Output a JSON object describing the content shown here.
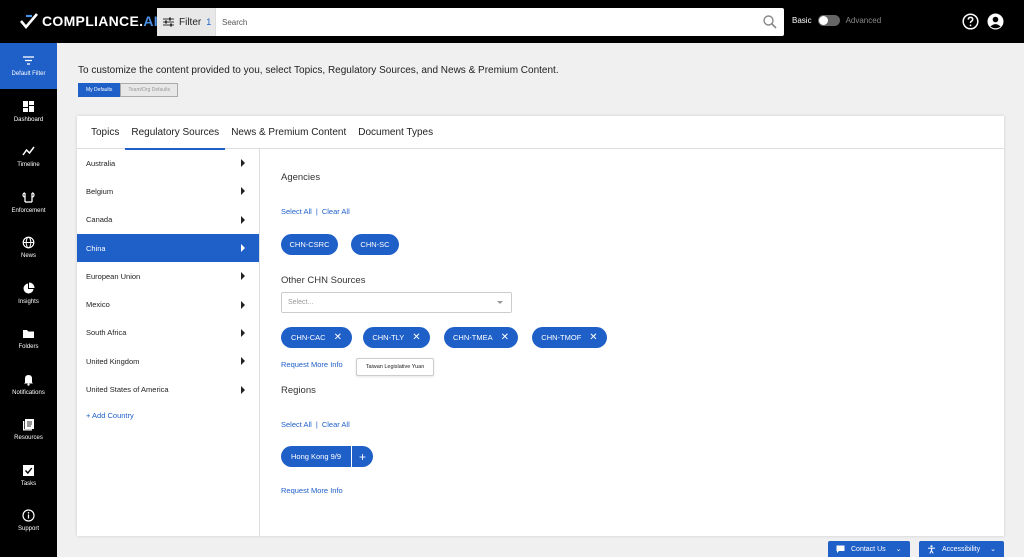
{
  "brand": {
    "name_main": "COMPLIANCE",
    "name_dot": ".",
    "name_ai": "AI"
  },
  "header": {
    "filter_label": "Filter",
    "filter_count": "1",
    "search_placeholder": "Search",
    "mode_basic": "Basic",
    "mode_advanced": "Advanced"
  },
  "sidebar": {
    "items": [
      {
        "label": "Default Filter",
        "icon": "filter-icon"
      },
      {
        "label": "Dashboard",
        "icon": "dashboard-icon"
      },
      {
        "label": "Timeline",
        "icon": "timeline-icon"
      },
      {
        "label": "Enforcement",
        "icon": "enforcement-icon"
      },
      {
        "label": "News",
        "icon": "globe-icon"
      },
      {
        "label": "Insights",
        "icon": "pie-chart-icon"
      },
      {
        "label": "Folders",
        "icon": "folder-icon"
      },
      {
        "label": "Notifications",
        "icon": "bell-icon"
      },
      {
        "label": "Resources",
        "icon": "resources-icon"
      },
      {
        "label": "Tasks",
        "icon": "checkbox-icon"
      },
      {
        "label": "Support",
        "icon": "info-icon"
      }
    ]
  },
  "main": {
    "intro": "To customize the content provided to you, select Topics, Regulatory Sources, and News & Premium Content.",
    "defaults": {
      "my": "My Defaults",
      "team": "Team/Org Defaults"
    },
    "tabs": [
      "Topics",
      "Regulatory Sources",
      "News & Premium Content",
      "Document Types"
    ],
    "countries": [
      "Australia",
      "Belgium",
      "Canada",
      "China",
      "European Union",
      "Mexico",
      "South Africa",
      "United Kingdom",
      "United States of America"
    ],
    "add_country": "+ Add Country",
    "agencies": {
      "title": "Agencies",
      "select_all": "Select All",
      "sep": "|",
      "clear_all": "Clear All",
      "pills": [
        "CHN-CSRC",
        "CHN-SC"
      ]
    },
    "other": {
      "title": "Other CHN Sources",
      "select_placeholder": "Select...",
      "pills": [
        "CHN-CAC",
        "CHN-TLY",
        "CHN-TMEA",
        "CHN-TMOF"
      ],
      "remove_glyph": "✕",
      "tooltip": "Taiwan Legislative Yuan",
      "request": "Request More Info"
    },
    "regions": {
      "title": "Regions",
      "select_all": "Select All",
      "sep": "|",
      "clear_all": "Clear All",
      "hk_label": "Hong Kong 9/9",
      "hk_add": "+",
      "request": "Request More Info"
    }
  },
  "footer": {
    "contact": "Contact Us",
    "accessibility": "Accessibility",
    "chev": "⌄"
  }
}
